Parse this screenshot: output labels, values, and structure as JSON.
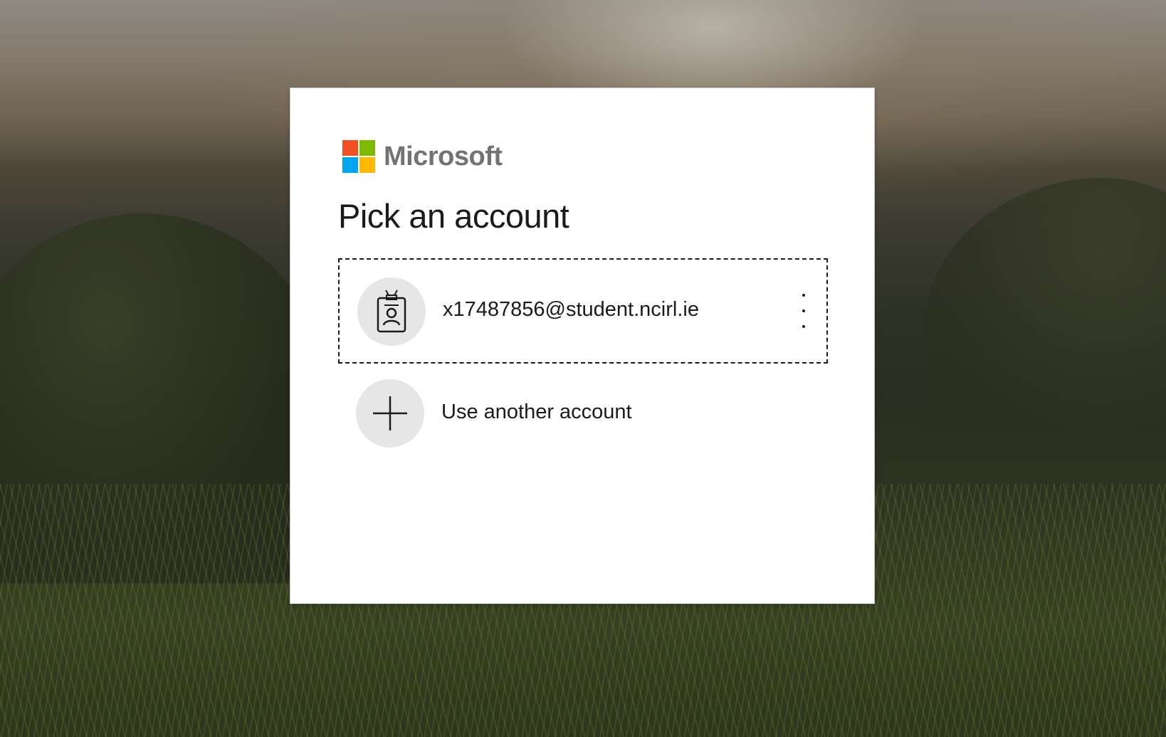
{
  "brand": {
    "name": "Microsoft",
    "colors": {
      "red": "#f25022",
      "green": "#7fba00",
      "blue": "#00a4ef",
      "yellow": "#ffb900"
    }
  },
  "dialog": {
    "title": "Pick an account",
    "accounts": [
      {
        "email": "x17487856@student.ncirl.ie",
        "icon": "badge-person-icon",
        "menu_icon": "more-options-icon"
      }
    ],
    "use_another": {
      "label": "Use another account",
      "icon": "plus-icon"
    }
  }
}
